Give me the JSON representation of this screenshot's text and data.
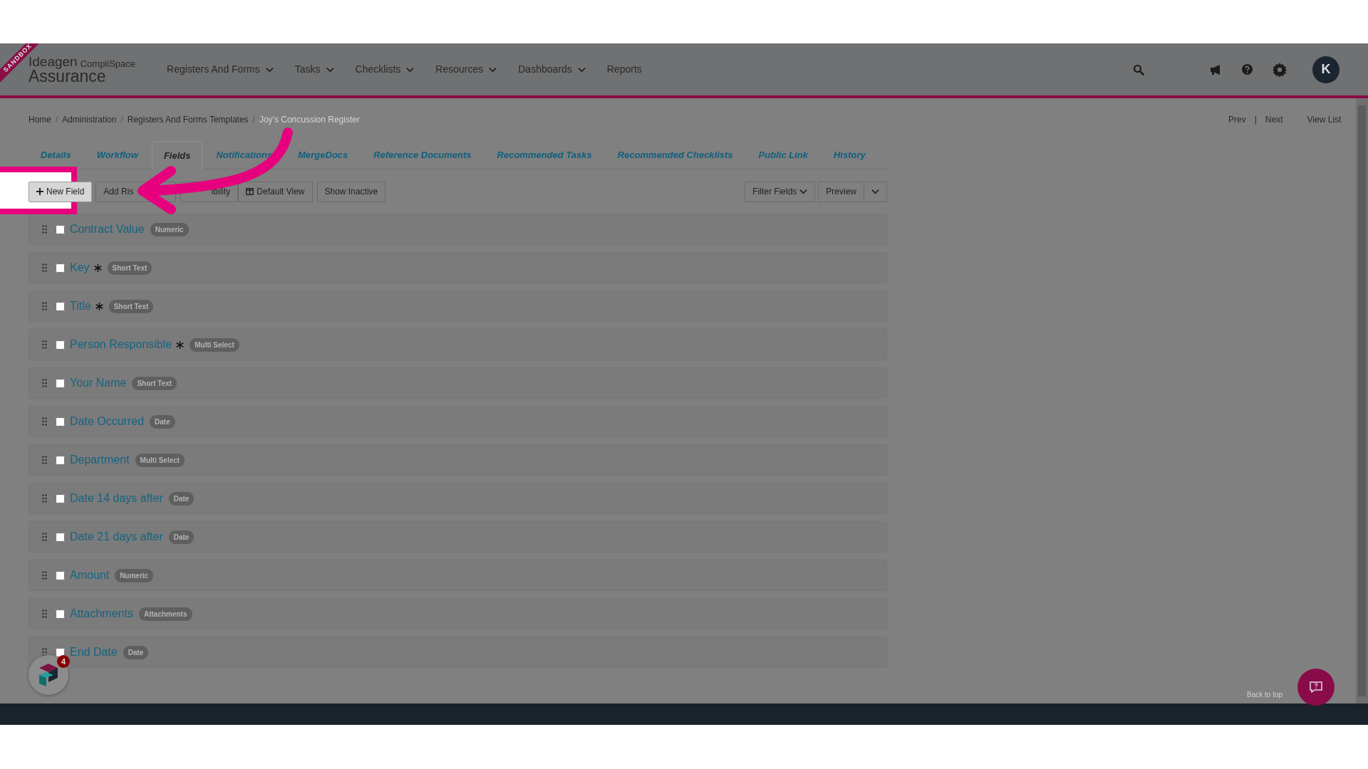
{
  "nav": {
    "ribbon": "SANDBOX",
    "brand": "Ideagen",
    "product": "CompliSpace",
    "subtitle": "Assurance",
    "menu": [
      {
        "label": "Registers And Forms",
        "dropdown": true
      },
      {
        "label": "Tasks",
        "dropdown": true
      },
      {
        "label": "Checklists",
        "dropdown": true
      },
      {
        "label": "Resources",
        "dropdown": true
      },
      {
        "label": "Dashboards",
        "dropdown": true
      },
      {
        "label": "Reports",
        "dropdown": false
      }
    ],
    "avatar": "K"
  },
  "breadcrumb": [
    "Home",
    "Administration",
    "Registers And Forms Templates",
    "Joy's Concussion Register"
  ],
  "breadcrumb_separator": "/",
  "pager": [
    "Prev",
    "Next"
  ],
  "pager_separator": "|",
  "view_list": "View List",
  "tabs": [
    {
      "label": "Details",
      "selected": false
    },
    {
      "label": "Workflow",
      "selected": false
    },
    {
      "label": "Fields",
      "selected": true
    },
    {
      "label": "Notifications",
      "selected": false
    },
    {
      "label": "MergeDocs",
      "selected": false
    },
    {
      "label": "Reference Documents",
      "selected": false
    },
    {
      "label": "Recommended Tasks",
      "selected": false
    },
    {
      "label": "Recommended Checklists",
      "selected": false
    },
    {
      "label": "Public Link",
      "selected": false
    },
    {
      "label": "History",
      "selected": false
    }
  ],
  "toolbar": [
    {
      "label": "New Field",
      "kind": "plus",
      "highlighted": true
    },
    {
      "label": "Add Ris",
      "kind": "plain",
      "highlighted": false
    },
    {
      "label": "ibility",
      "kind": "plain",
      "highlighted": false
    },
    {
      "label": "Default View",
      "kind": "columns",
      "highlighted": false
    },
    {
      "label": "Show Inactive",
      "kind": "plain",
      "highlighted": false
    }
  ],
  "filter": "Filter Fields",
  "preview": "Preview",
  "fields": [
    {
      "name": "Contract Value",
      "required": false,
      "type": "Numeric",
      "checked": false
    },
    {
      "name": "Key",
      "required": true,
      "type": "Short Text",
      "checked": false
    },
    {
      "name": "Title",
      "required": true,
      "type": "Short Text",
      "checked": false
    },
    {
      "name": "Person Responsible",
      "required": true,
      "type": "Multi Select",
      "checked": false
    },
    {
      "name": "Your Name",
      "required": false,
      "type": "Short Text",
      "checked": false
    },
    {
      "name": "Date Occurred",
      "required": false,
      "type": "Date",
      "checked": false
    },
    {
      "name": "Department",
      "required": false,
      "type": "Multi Select",
      "checked": false
    },
    {
      "name": "Date 14 days after",
      "required": false,
      "type": "Date",
      "checked": false
    },
    {
      "name": "Date 21 days after",
      "required": false,
      "type": "Date",
      "checked": false
    },
    {
      "name": "Amount",
      "required": false,
      "type": "Numeric",
      "checked": false
    },
    {
      "name": "Attachments",
      "required": false,
      "type": "Attachments",
      "checked": false
    },
    {
      "name": "End Date",
      "required": false,
      "type": "Date",
      "checked": false
    }
  ],
  "back_to_top": "Back to top",
  "widget_badge": "4"
}
